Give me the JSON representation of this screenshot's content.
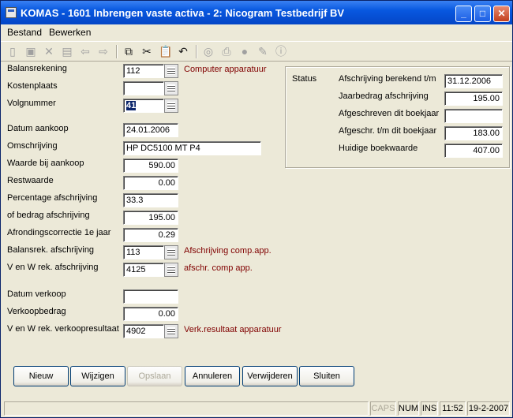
{
  "window": {
    "title": "KOMAS - 1601 Inbrengen vaste activa - 2: Nicogram Testbedrijf BV"
  },
  "menu": {
    "bestand": "Bestand",
    "bewerken": "Bewerken"
  },
  "form": {
    "balansrekening": {
      "label": "Balansrekening",
      "value": "112",
      "desc": "Computer apparatuur"
    },
    "kostenplaats": {
      "label": "Kostenplaats",
      "value": ""
    },
    "volgnummer": {
      "label": "Volgnummer",
      "value": "41"
    },
    "datum_aankoop": {
      "label": "Datum aankoop",
      "value": "24.01.2006"
    },
    "omschrijving": {
      "label": "Omschrijving",
      "value": "HP DC5100 MT P4"
    },
    "waarde_aankoop": {
      "label": "Waarde bij aankoop",
      "value": "590.00"
    },
    "restwaarde": {
      "label": "Restwaarde",
      "value": "0.00"
    },
    "percentage": {
      "label": "Percentage afschrijving",
      "value": "33.3"
    },
    "bedrag_afschrijving": {
      "label": " of bedrag afschrijving",
      "value": "195.00"
    },
    "afrondingscorrectie": {
      "label": "Afrondingscorrectie 1e jaar",
      "value": "0.29"
    },
    "balansrek_afschrijving": {
      "label": "Balansrek. afschrijving",
      "value": "113",
      "desc": "Afschrijving comp.app."
    },
    "venw_afschrijving": {
      "label": "V en W rek. afschrijving",
      "value": "4125",
      "desc": "afschr. comp app."
    },
    "datum_verkoop": {
      "label": "Datum verkoop",
      "value": ""
    },
    "verkoopbedrag": {
      "label": "Verkoopbedrag",
      "value": "0.00"
    },
    "venw_verkoopresultaat": {
      "label": "V en W rek. verkoopresultaat",
      "value": "4902",
      "desc": "Verk.resultaat apparatuur"
    }
  },
  "status": {
    "label": "Status",
    "rows": [
      {
        "label": "Afschrijving berekend t/m",
        "value": "31.12.2006"
      },
      {
        "label": "Jaarbedrag afschrijving",
        "value": "195.00"
      },
      {
        "label": "Afgeschreven dit boekjaar",
        "value": ""
      },
      {
        "label": "Afgeschr. t/m dit boekjaar",
        "value": "183.00"
      },
      {
        "label": "Huidige boekwaarde",
        "value": "407.00"
      }
    ]
  },
  "buttons": {
    "nieuw": "Nieuw",
    "wijzigen": "Wijzigen",
    "opslaan": "Opslaan",
    "annuleren": "Annuleren",
    "verwijderen": "Verwijderen",
    "sluiten": "Sluiten"
  },
  "statusbar": {
    "caps": "CAPS",
    "num": "NUM",
    "ins": "INS",
    "time": "11:52",
    "date": "19-2-2007"
  }
}
